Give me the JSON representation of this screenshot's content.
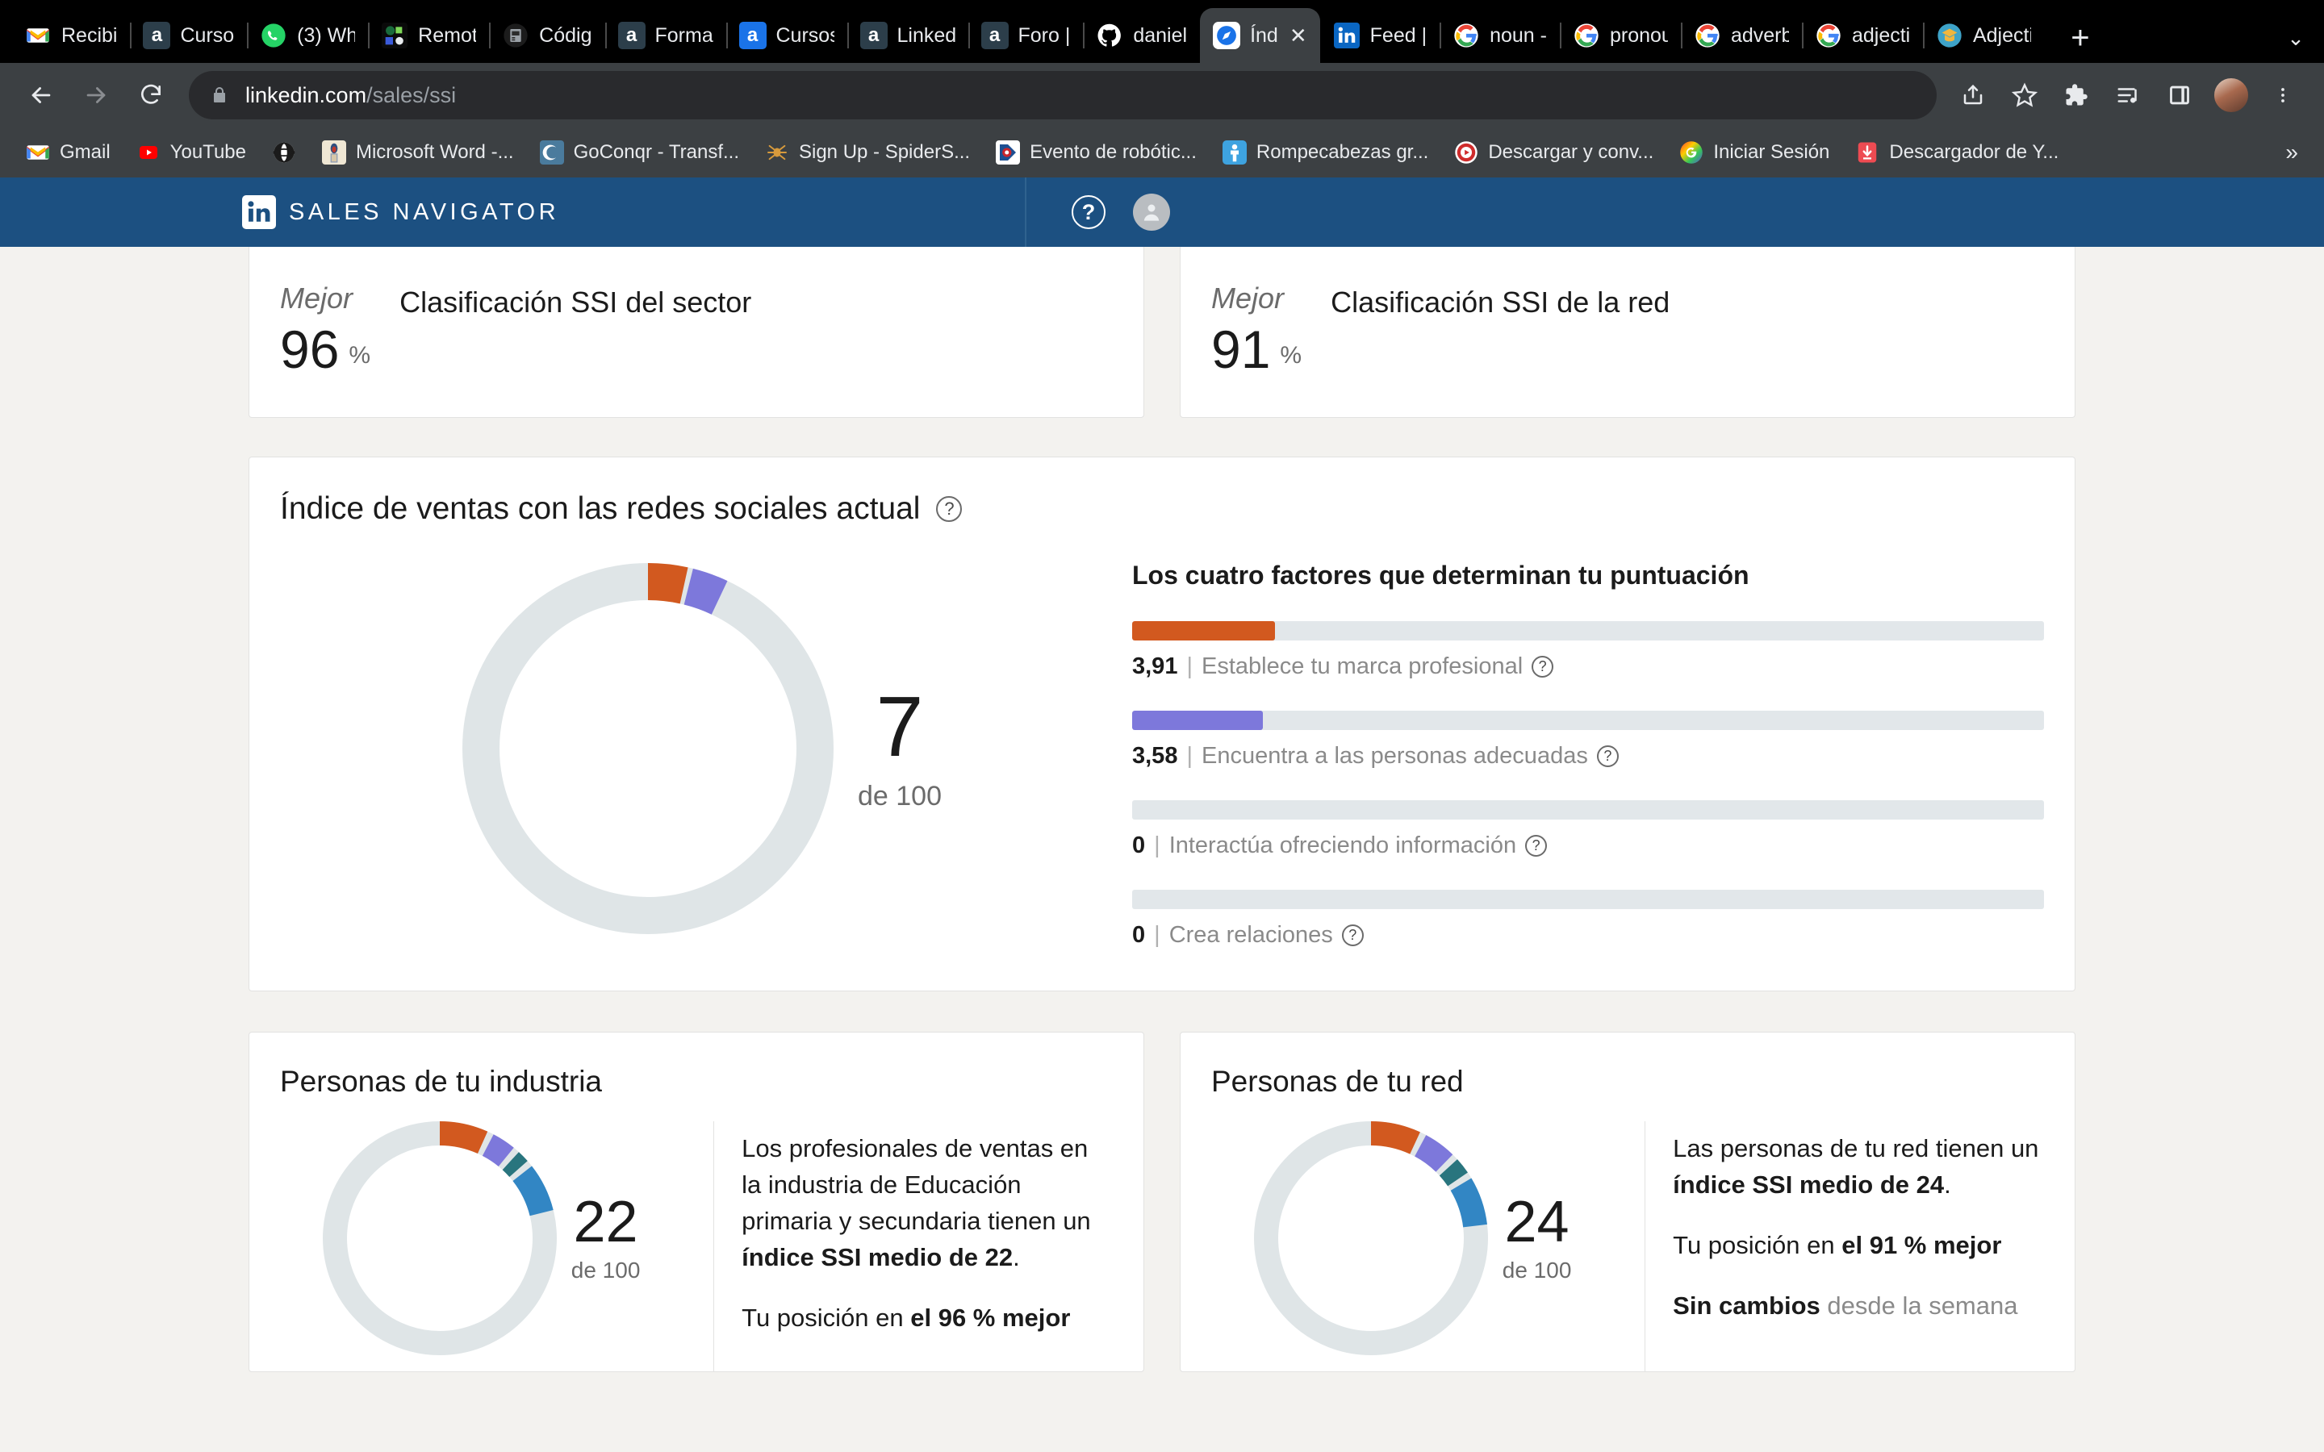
{
  "browser": {
    "tabs": [
      {
        "title": "Recibi",
        "favicon": "gmail-icon",
        "active": false
      },
      {
        "title": "Curso",
        "favicon": "alison-icon",
        "active": false
      },
      {
        "title": "(3) Wh",
        "favicon": "whatsapp-icon",
        "active": false
      },
      {
        "title": "Remot",
        "favicon": "remote-icon",
        "active": false
      },
      {
        "title": "Códig",
        "favicon": "code-icon",
        "active": false
      },
      {
        "title": "Forma",
        "favicon": "alison-icon",
        "active": false
      },
      {
        "title": "Cursos",
        "favicon": "alison-icon",
        "active": false
      },
      {
        "title": "Linked",
        "favicon": "alison-icon",
        "active": false
      },
      {
        "title": "Foro |",
        "favicon": "alison-icon",
        "active": false
      },
      {
        "title": "daniel",
        "favicon": "github-icon",
        "active": false
      },
      {
        "title": "Índ",
        "favicon": "compass-icon",
        "active": true
      },
      {
        "title": "Feed |",
        "favicon": "linkedin-icon",
        "active": false
      },
      {
        "title": "noun -",
        "favicon": "google-icon",
        "active": false
      },
      {
        "title": "pronou",
        "favicon": "google-icon",
        "active": false
      },
      {
        "title": "adverb",
        "favicon": "google-icon",
        "active": false
      },
      {
        "title": "adjecti",
        "favicon": "google-icon",
        "active": false
      },
      {
        "title": "Adjecti",
        "favicon": "mail-edu-icon",
        "active": false
      }
    ],
    "new_tab_label": "+",
    "tab_list_label": "⌄",
    "close_label": "✕",
    "url_domain": "linkedin.com",
    "url_path": "/sales/ssi",
    "bookmarks": [
      {
        "label": "Gmail",
        "favicon": "gmail-icon"
      },
      {
        "label": "YouTube",
        "favicon": "youtube-icon"
      },
      {
        "label": "",
        "favicon": "globe-icon"
      },
      {
        "label": "Microsoft Word -...",
        "favicon": "word-doc-icon"
      },
      {
        "label": "GoConqr - Transf...",
        "favicon": "goconqr-icon"
      },
      {
        "label": "Sign Up - SpiderS...",
        "favicon": "spider-icon"
      },
      {
        "label": "Evento de robótic...",
        "favicon": "robotics-icon"
      },
      {
        "label": "Rompecabezas gr...",
        "favicon": "puzzle-person-icon"
      },
      {
        "label": "Descargar y conv...",
        "favicon": "converter-icon"
      },
      {
        "label": "Iniciar Sesión",
        "favicon": "rainbow-g-icon"
      },
      {
        "label": "Descargador de Y...",
        "favicon": "download-icon"
      }
    ],
    "bookmarks_overflow_label": "»"
  },
  "sales_nav": {
    "brand": "SALES NAVIGATOR",
    "logo_text": "in",
    "help_label": "?"
  },
  "rank_cards": [
    {
      "label": "Mejor",
      "value": "96",
      "unit": "%",
      "title": "Clasificación SSI del sector"
    },
    {
      "label": "Mejor",
      "value": "91",
      "unit": "%",
      "title": "Clasificación SSI de la red"
    }
  ],
  "ssi": {
    "title": "Índice de ventas con las redes sociales actual",
    "help_label": "?",
    "score": "7",
    "score_of": "de 100",
    "factors_title": "Los cuatro factores que determinan tu puntuación",
    "factors": [
      {
        "value": "3,91",
        "sep": "|",
        "label": "Establece tu marca profesional",
        "help_label": "?",
        "color": "#d2591f"
      },
      {
        "value": "3,58",
        "sep": "|",
        "label": "Encuentra a las personas adecuadas",
        "help_label": "?",
        "color": "#7d78db"
      },
      {
        "value": "0",
        "sep": "|",
        "label": "Interactúa ofreciendo información",
        "help_label": "?",
        "color": "#29757e"
      },
      {
        "value": "0",
        "sep": "|",
        "label": "Crea relaciones",
        "help_label": "?",
        "color": "#3286c4"
      }
    ]
  },
  "people_cards": [
    {
      "title": "Personas de tu industria",
      "score": "22",
      "score_of": "de 100",
      "lines": [
        [
          {
            "t": "Los profesionales de ventas en la industria de Educación primaria y secundaria tienen un ",
            "b": false
          },
          {
            "t": "índice SSI medio de 22",
            "b": true
          },
          {
            "t": ".",
            "b": false
          }
        ],
        [
          {
            "t": "Tu posición en ",
            "b": false
          },
          {
            "t": "el 96 % mejor",
            "b": true
          }
        ]
      ]
    },
    {
      "title": "Personas de tu red",
      "score": "24",
      "score_of": "de 100",
      "lines": [
        [
          {
            "t": "Las personas de tu red tienen un ",
            "b": false
          },
          {
            "t": "índice SSI medio de 24",
            "b": true
          },
          {
            "t": ".",
            "b": false
          }
        ],
        [
          {
            "t": "Tu posición en ",
            "b": false
          },
          {
            "t": "el 91 % mejor",
            "b": true
          }
        ],
        [
          {
            "t": "Sin cambios",
            "b": true
          },
          {
            "t": " desde la semana",
            "b": false,
            "muted": true
          }
        ]
      ]
    }
  ],
  "colors": {
    "brand_blue": "#1c5081",
    "page_bg": "#f3f2ef",
    "track": "#e2e7ea",
    "orange": "#d2591f",
    "purple": "#7d78db",
    "teal": "#29757e",
    "blue": "#3286c4"
  },
  "chart_data": [
    {
      "type": "pie",
      "title": "Índice de ventas con las redes sociales actual",
      "total": 100,
      "center_value": 7,
      "center_label": "de 100",
      "slices": [
        {
          "name": "Establece tu marca profesional",
          "value": 3.91,
          "color": "#d2591f"
        },
        {
          "name": "Encuentra a las personas adecuadas",
          "value": 3.58,
          "color": "#7d78db"
        },
        {
          "name": "Interactúa ofreciendo información",
          "value": 0,
          "color": "#29757e"
        },
        {
          "name": "Crea relaciones",
          "value": 0,
          "color": "#3286c4"
        },
        {
          "name": "Restante",
          "value": 92.51,
          "color": "#dfe5e7"
        }
      ]
    },
    {
      "type": "bar",
      "title": "Los cuatro factores que determinan tu puntuación",
      "categories": [
        "Establece tu marca profesional",
        "Encuentra a las personas adecuadas",
        "Interactúa ofreciendo información",
        "Crea relaciones"
      ],
      "values": [
        3.91,
        3.58,
        0,
        0
      ],
      "xlim": [
        0,
        25
      ],
      "ylabel": "",
      "xlabel": "",
      "grid": false,
      "orientation": "horizontal",
      "colors": [
        "#d2591f",
        "#7d78db",
        "#29757e",
        "#3286c4"
      ]
    },
    {
      "type": "pie",
      "title": "Personas de tu industria",
      "total": 100,
      "center_value": 22,
      "center_label": "de 100",
      "slices": [
        {
          "name": "Establece tu marca profesional",
          "value": 7.6,
          "color": "#d2591f"
        },
        {
          "name": "Encuentra a las personas adecuadas",
          "value": 4.2,
          "color": "#7d78db"
        },
        {
          "name": "Interactúa ofreciendo información",
          "value": 2.6,
          "color": "#29757e"
        },
        {
          "name": "Crea relaciones",
          "value": 7.6,
          "color": "#3286c4"
        },
        {
          "name": "Restante",
          "value": 78,
          "color": "#dfe5e7"
        }
      ]
    },
    {
      "type": "pie",
      "title": "Personas de tu red",
      "total": 100,
      "center_value": 24,
      "center_label": "de 100",
      "slices": [
        {
          "name": "Establece tu marca profesional",
          "value": 7.8,
          "color": "#d2591f"
        },
        {
          "name": "Encuentra a las personas adecuadas",
          "value": 5.4,
          "color": "#7d78db"
        },
        {
          "name": "Interactúa ofreciendo información",
          "value": 3.2,
          "color": "#29757e"
        },
        {
          "name": "Crea relaciones",
          "value": 7.6,
          "color": "#3286c4"
        },
        {
          "name": "Restante",
          "value": 76,
          "color": "#dfe5e7"
        }
      ]
    }
  ]
}
